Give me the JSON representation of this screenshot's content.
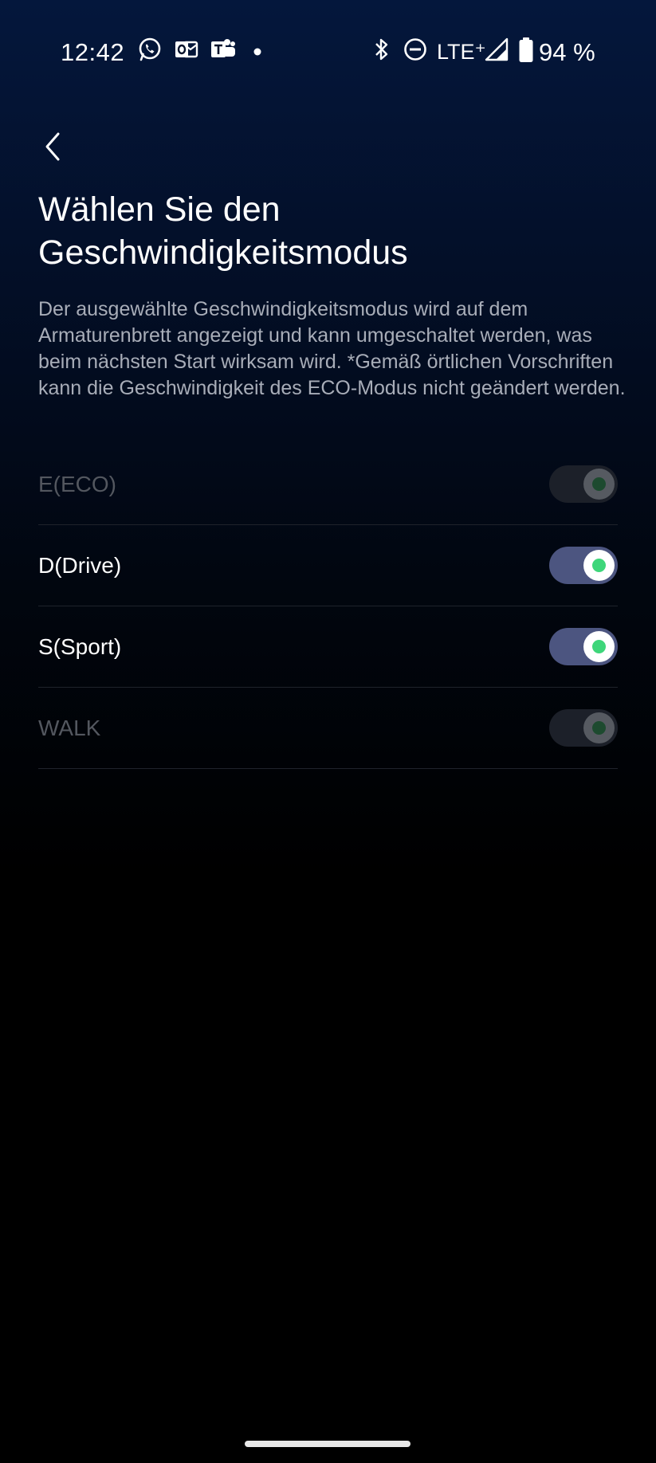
{
  "status_bar": {
    "time": "12:42",
    "left_icons": [
      "whatsapp-icon",
      "outlook-icon",
      "teams-icon",
      "notification-dot-icon"
    ],
    "right_icons": [
      "bluetooth-icon",
      "do-not-disturb-icon",
      "signal-icon",
      "battery-icon"
    ],
    "network": "LTE⁺",
    "battery": "94 %"
  },
  "header": {
    "back_icon": "chevron-left-icon",
    "title": "Wählen Sie den Geschwindigkeitsmodus",
    "description": "Der ausgewählte Geschwindigkeitsmodus wird auf dem Armaturenbrett angezeigt und kann umgeschaltet werden, was beim nächsten Start wirksam wird. *Gemäß örtlichen Vorschriften kann die Geschwindigkeit des ECO-Modus nicht geändert werden."
  },
  "modes": [
    {
      "label": "E(ECO)",
      "enabled": true,
      "disabled": true
    },
    {
      "label": "D(Drive)",
      "enabled": true,
      "disabled": false
    },
    {
      "label": "S(Sport)",
      "enabled": true,
      "disabled": false
    },
    {
      "label": "WALK",
      "enabled": true,
      "disabled": true
    }
  ],
  "colors": {
    "toggle_on": "#4c5580",
    "toggle_dot": "#3ed67a",
    "toggle_disabled": "#1c2029",
    "background_top": "#04173c"
  }
}
